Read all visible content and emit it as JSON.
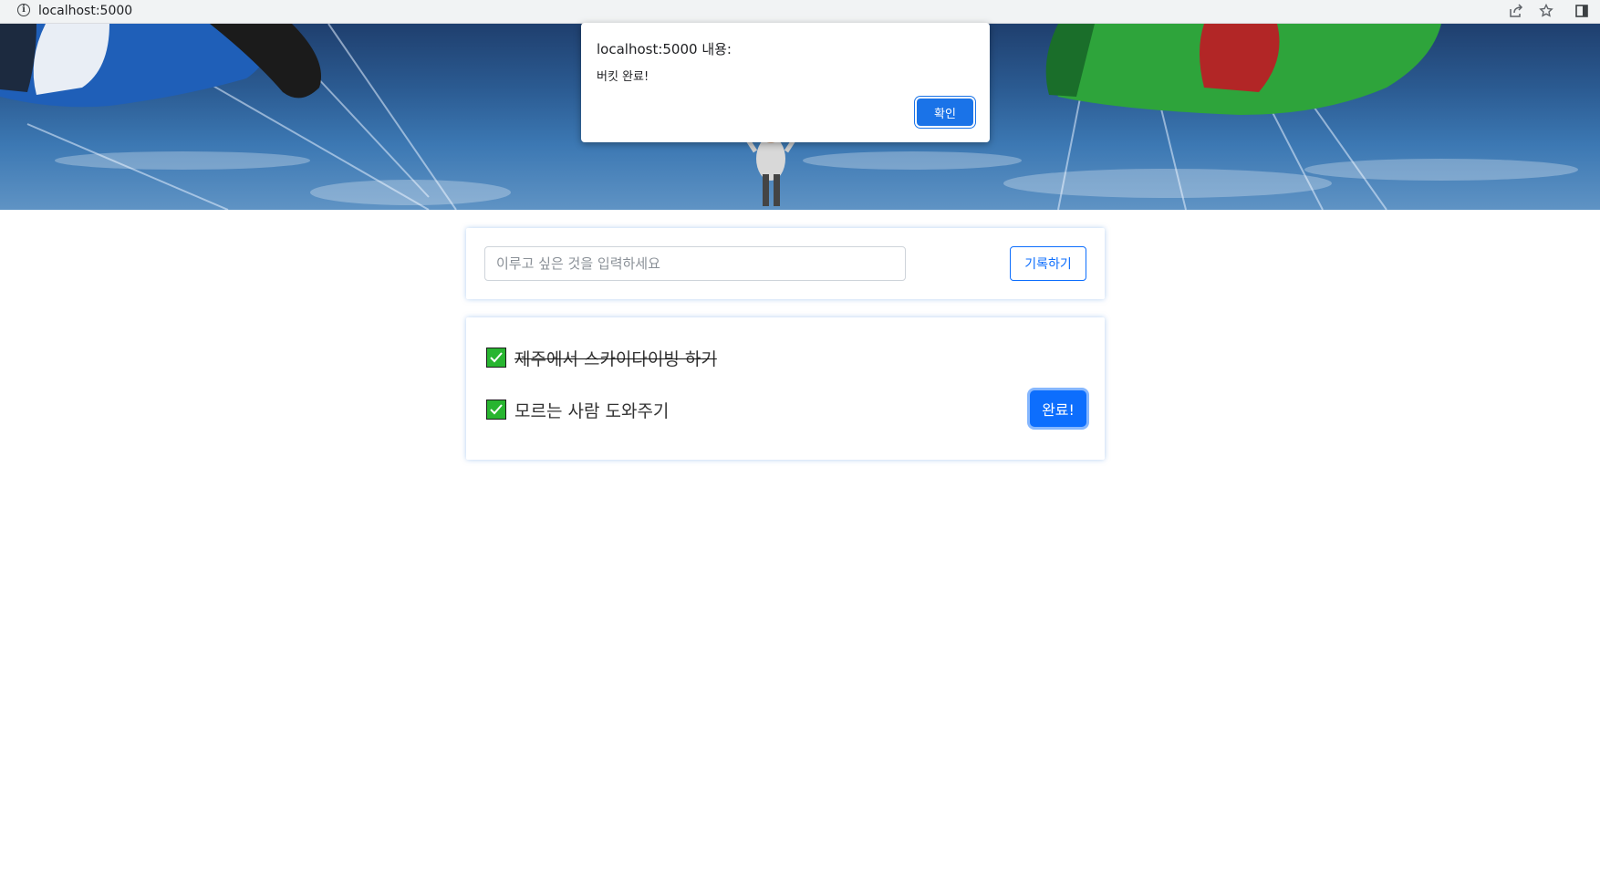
{
  "browser": {
    "url": "localhost:5000",
    "icons": [
      "info-icon",
      "share-icon",
      "star-icon",
      "sidebar-icon"
    ]
  },
  "alert": {
    "title": "localhost:5000 내용:",
    "message": "버킷 완료!",
    "ok_label": "확인"
  },
  "form": {
    "input_placeholder": "이루고 싶은 것을 입력하세요",
    "input_value": "",
    "submit_label": "기록하기"
  },
  "bucket_list": {
    "items": [
      {
        "label": "제주에서 스카이다이빙 하기",
        "done": true
      },
      {
        "label": "모르는 사람 도와주기",
        "done": false
      }
    ],
    "complete_label": "완료!"
  },
  "colors": {
    "primary": "#0d6efd",
    "check_green": "#28b530",
    "alert_button": "#1a73e8"
  }
}
